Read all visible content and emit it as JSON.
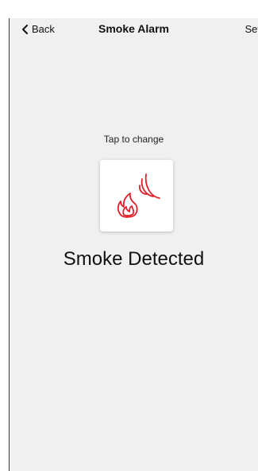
{
  "header": {
    "back_label": "Back",
    "title": "Smoke Alarm",
    "right_label": "Set"
  },
  "main": {
    "hint": "Tap to change",
    "status": "Smoke Detected",
    "icon": "smoke-alarm-icon",
    "icon_color": "#e0202a"
  }
}
